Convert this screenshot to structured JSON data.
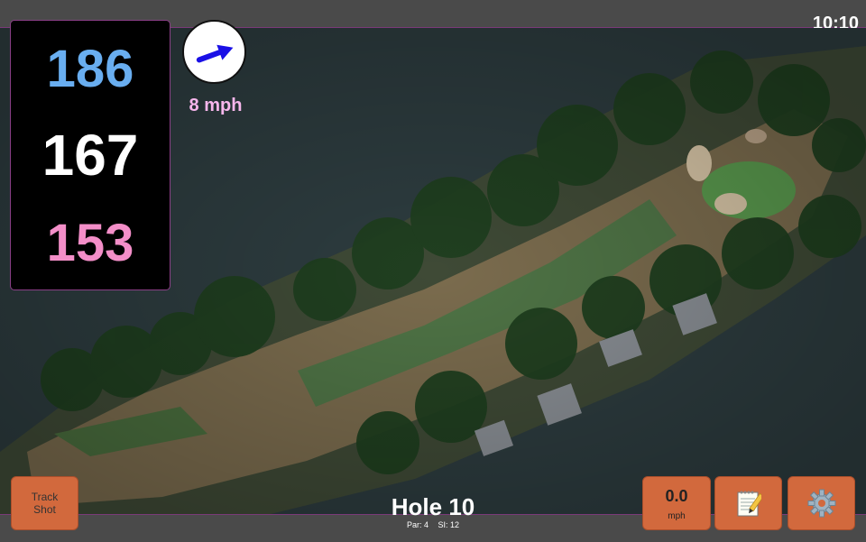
{
  "status": {
    "time": "10:10"
  },
  "distances": {
    "back": "186",
    "middle": "167",
    "front": "153"
  },
  "wind": {
    "speed_text": "8 mph",
    "direction_icon": "arrow-icon"
  },
  "hole": {
    "title": "Hole 10",
    "par_text": "Par: 4",
    "si_text": "SI: 12"
  },
  "buttons": {
    "track_shot_line1": "Track",
    "track_shot_line2": "Shot",
    "speed_value": "0.0",
    "speed_unit": "mph",
    "notes_icon": "notepad-icon",
    "settings_icon": "gear-icon"
  },
  "colors": {
    "accent_back": "#69aef0",
    "accent_front": "#f38ec8",
    "button": "#d2693d",
    "wind_text": "#f7b6ec"
  }
}
